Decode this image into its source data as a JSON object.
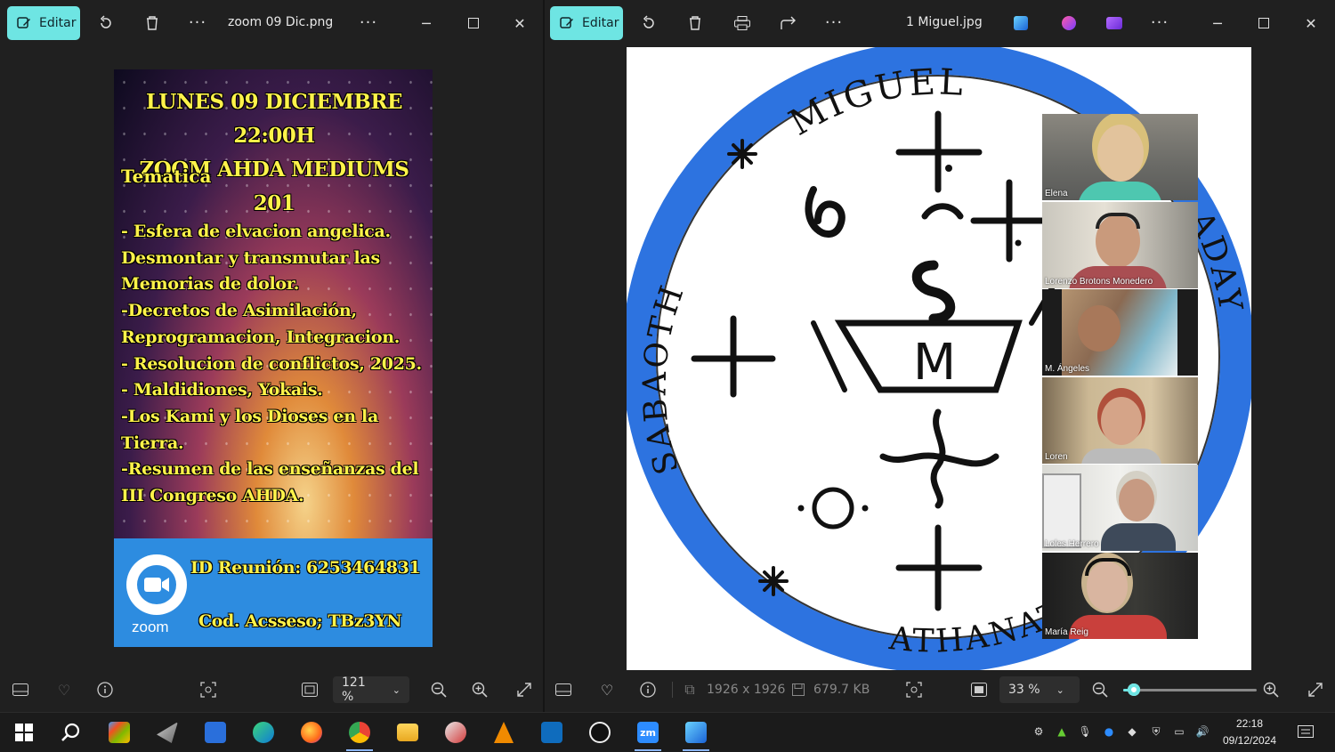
{
  "left_window": {
    "edit_label": "Editar",
    "title": "zoom 09 Dic.png",
    "zoom_value": "121 %",
    "poster": {
      "heading_line1": "LUNES 09 DICIEMBRE 22:00H",
      "heading_line2": "ZOOM AHDA MEDIUMS 201",
      "tematica": "Tematica",
      "body": "- Esfera de elvacion angelica.\nDesmontar y transmutar las\nMemorias de dolor.\n-Decretos de Asimilación,\nReprogramacion, Integracion.\n- Resolucion de  conflictos, 2025.\n- Maldidiones, Yokais.\n-Los Kami y los Dioses en la\nTierra.\n-Resumen de las enseñanzas del\nIII Congreso AHDA.",
      "meeting_id": "ID Reunión: 6253464831",
      "access_code": "Cod. Acsseso; TBz3YN",
      "zoom_logo_text": "zoom"
    }
  },
  "right_window": {
    "edit_label": "Editar",
    "title": "1 Miguel.jpg",
    "dimensions": "1926 x 1926",
    "file_size": "679.7 KB",
    "zoom_value": "33 %",
    "zoom_slider_fraction": 0.08,
    "seal": {
      "top_text": "MIGUEL",
      "left_text": "SABAOTH",
      "bottom_text": "ATHANATOS",
      "right_text": "ADAY",
      "center_letter": "M",
      "accent_color": "#2d73e0"
    },
    "participants": [
      {
        "name": "Elena"
      },
      {
        "name": "Lorenzo Brotons Monedero"
      },
      {
        "name": "M. Ángeles"
      },
      {
        "name": "Loren"
      },
      {
        "name": "Loles Herrero"
      },
      {
        "name": "María Reig"
      }
    ]
  },
  "taskbar": {
    "time": "22:18",
    "date": "09/12/2024"
  },
  "colors": {
    "edit_button": "#6ee5e3",
    "poster_text": "#fff34a",
    "zoom_blue": "#2d8ce0"
  }
}
